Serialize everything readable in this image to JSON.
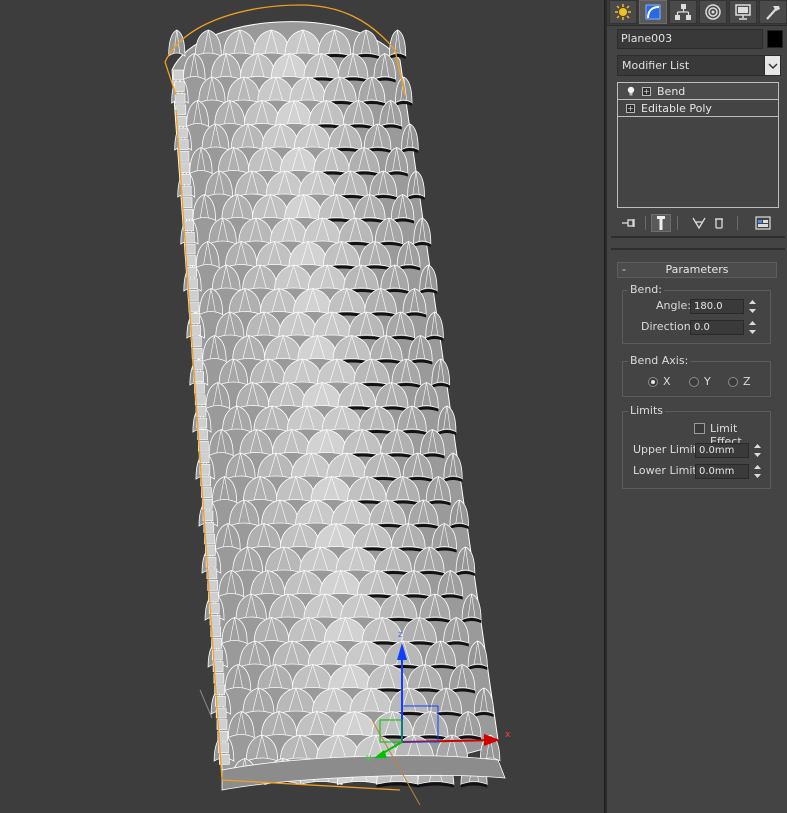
{
  "command_panel": {
    "tabs": [
      {
        "icon": "create-icon",
        "active": false
      },
      {
        "icon": "modify-icon",
        "active": true
      },
      {
        "icon": "hierarchy-icon",
        "active": false
      },
      {
        "icon": "motion-icon",
        "active": false
      },
      {
        "icon": "display-icon",
        "active": false
      },
      {
        "icon": "utilities-icon",
        "active": false
      }
    ],
    "object_name": "Plane003",
    "object_color": "#000000",
    "modifier_list_label": "Modifier List",
    "stack": [
      {
        "label": "Bend",
        "selected": true
      },
      {
        "label": "Editable Poly",
        "selected": false
      }
    ],
    "parameters": {
      "title": "Parameters",
      "collapse_symbol": "-",
      "bend": {
        "group_label": "Bend:",
        "angle_label": "Angle:",
        "angle_value": "180.0",
        "direction_label": "Direction:",
        "direction_value": "0.0"
      },
      "bend_axis": {
        "group_label": "Bend Axis:",
        "options": [
          "X",
          "Y",
          "Z"
        ],
        "selected": "X"
      },
      "limits": {
        "group_label": "Limits",
        "limit_effect_label": "Limit Effect",
        "limit_effect_checked": false,
        "upper_label": "Upper Limit:",
        "upper_value": "0.0mm",
        "lower_label": "Lower Limit:",
        "lower_value": "0.0mm"
      }
    }
  },
  "viewport": {
    "gizmo_labels": {
      "z": "z",
      "x": "x",
      "y": "y"
    },
    "colors": {
      "background": "#3d3d3d",
      "selection_bracket": "#f0a020",
      "mesh_fill": "#a8a8a8",
      "mesh_wire": "#ffffff",
      "gizmo_x": "#d00000",
      "gizmo_y": "#00c000",
      "gizmo_z": "#1040ff"
    }
  }
}
